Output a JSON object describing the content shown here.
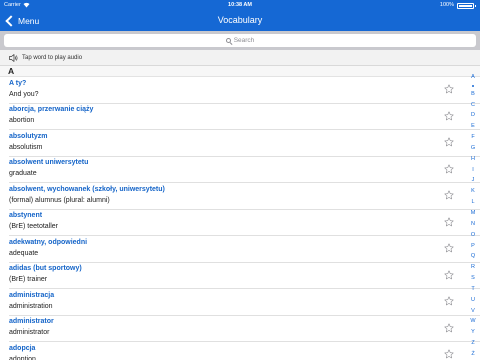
{
  "status_bar": {
    "carrier": "Carrier",
    "time": "10:38 AM",
    "battery": "100%"
  },
  "nav": {
    "back_label": "Menu",
    "title": "Vocabulary"
  },
  "search": {
    "placeholder": "Search"
  },
  "audio_hint": "Tap word to play audio",
  "section": "A",
  "entries": [
    {
      "word": "A ty?",
      "translation": "And you?"
    },
    {
      "word": "aborcja, przerwanie ciąży",
      "translation": "abortion"
    },
    {
      "word": "absolutyzm",
      "translation": "absolutism"
    },
    {
      "word": "absolwent uniwersytetu",
      "translation": "graduate"
    },
    {
      "word": "absolwent, wychowanek (szkoły, uniwersytetu)",
      "translation": "(formal) alumnus (plural: alumni)"
    },
    {
      "word": "abstynent",
      "translation": "(BrE) teetotaller"
    },
    {
      "word": "adekwatny, odpowiedni",
      "translation": "adequate"
    },
    {
      "word": "adidas (but sportowy)",
      "translation": "(BrE) trainer"
    },
    {
      "word": "administracja",
      "translation": "administration"
    },
    {
      "word": "administrator",
      "translation": "administrator"
    },
    {
      "word": "adopcja",
      "translation": "adoption"
    }
  ],
  "index": [
    "A",
    "•",
    "B",
    "C",
    "D",
    "E",
    "F",
    "G",
    "H",
    "I",
    "J",
    "K",
    "L",
    "M",
    "N",
    "O",
    "P",
    "Q",
    "R",
    "S",
    "T",
    "U",
    "V",
    "W",
    "Y",
    "Z",
    "Ż"
  ],
  "colors": {
    "nav_bar": "#1568d4",
    "link": "#1464c8",
    "search_bg": "#c9c9ce"
  }
}
